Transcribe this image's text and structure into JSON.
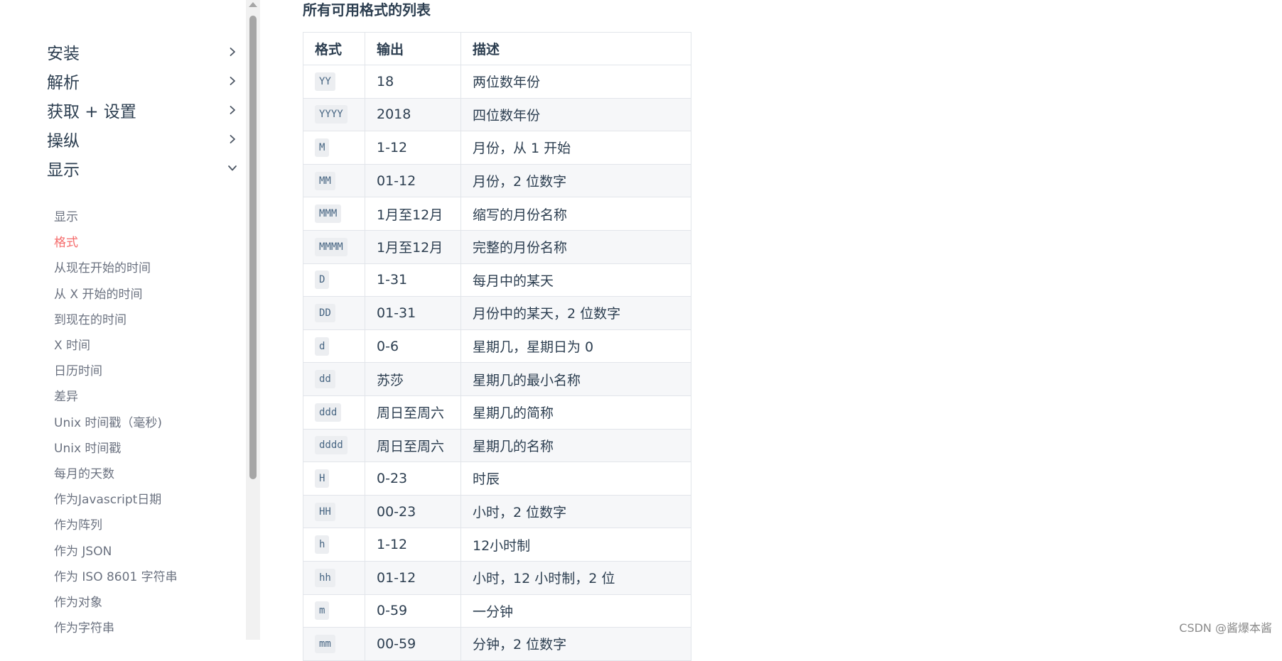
{
  "sidebar": {
    "sections": [
      {
        "label": "安装",
        "expanded": false
      },
      {
        "label": "解析",
        "expanded": false
      },
      {
        "label": "获取 + 设置",
        "expanded": false
      },
      {
        "label": "操纵",
        "expanded": false
      },
      {
        "label": "显示",
        "expanded": true
      }
    ],
    "items": [
      {
        "label": "显示",
        "active": false
      },
      {
        "label": "格式",
        "active": true
      },
      {
        "label": "从现在开始的时间",
        "active": false
      },
      {
        "label": "从 X 开始的时间",
        "active": false
      },
      {
        "label": "到现在的时间",
        "active": false
      },
      {
        "label": "X 时间",
        "active": false
      },
      {
        "label": "日历时间",
        "active": false
      },
      {
        "label": "差异",
        "active": false
      },
      {
        "label": "Unix 时间戳（毫秒)",
        "active": false
      },
      {
        "label": "Unix 时间戳",
        "active": false
      },
      {
        "label": "每月的天数",
        "active": false
      },
      {
        "label": "作为Javascript日期",
        "active": false
      },
      {
        "label": "作为阵列",
        "active": false
      },
      {
        "label": "作为 JSON",
        "active": false
      },
      {
        "label": "作为 ISO 8601 字符串",
        "active": false
      },
      {
        "label": "作为对象",
        "active": false
      },
      {
        "label": "作为字符串",
        "active": false
      }
    ],
    "active_color": "#f56c6c"
  },
  "main": {
    "title": "所有可用格式的列表",
    "table": {
      "headers": [
        "格式",
        "输出",
        "描述"
      ],
      "rows": [
        [
          "YY",
          "18",
          "两位数年份"
        ],
        [
          "YYYY",
          "2018",
          "四位数年份"
        ],
        [
          "M",
          "1-12",
          "月份，从 1 开始"
        ],
        [
          "MM",
          "01-12",
          "月份，2 位数字"
        ],
        [
          "MMM",
          "1月至12月",
          "缩写的月份名称"
        ],
        [
          "MMMM",
          "1月至12月",
          "完整的月份名称"
        ],
        [
          "D",
          "1-31",
          "每月中的某天"
        ],
        [
          "DD",
          "01-31",
          "月份中的某天，2 位数字"
        ],
        [
          "d",
          "0-6",
          "星期几，星期日为 0"
        ],
        [
          "dd",
          "苏莎",
          "星期几的最小名称"
        ],
        [
          "ddd",
          "周日至周六",
          "星期几的简称"
        ],
        [
          "dddd",
          "周日至周六",
          "星期几的名称"
        ],
        [
          "H",
          "0-23",
          "时辰"
        ],
        [
          "HH",
          "00-23",
          "小时，2 位数字"
        ],
        [
          "h",
          "1-12",
          "12小时制"
        ],
        [
          "hh",
          "01-12",
          "小时，12 小时制，2 位"
        ],
        [
          "m",
          "0-59",
          "一分钟"
        ],
        [
          "mm",
          "00-59",
          "分钟，2 位数字"
        ]
      ]
    }
  },
  "watermark": "CSDN @酱爆本酱"
}
